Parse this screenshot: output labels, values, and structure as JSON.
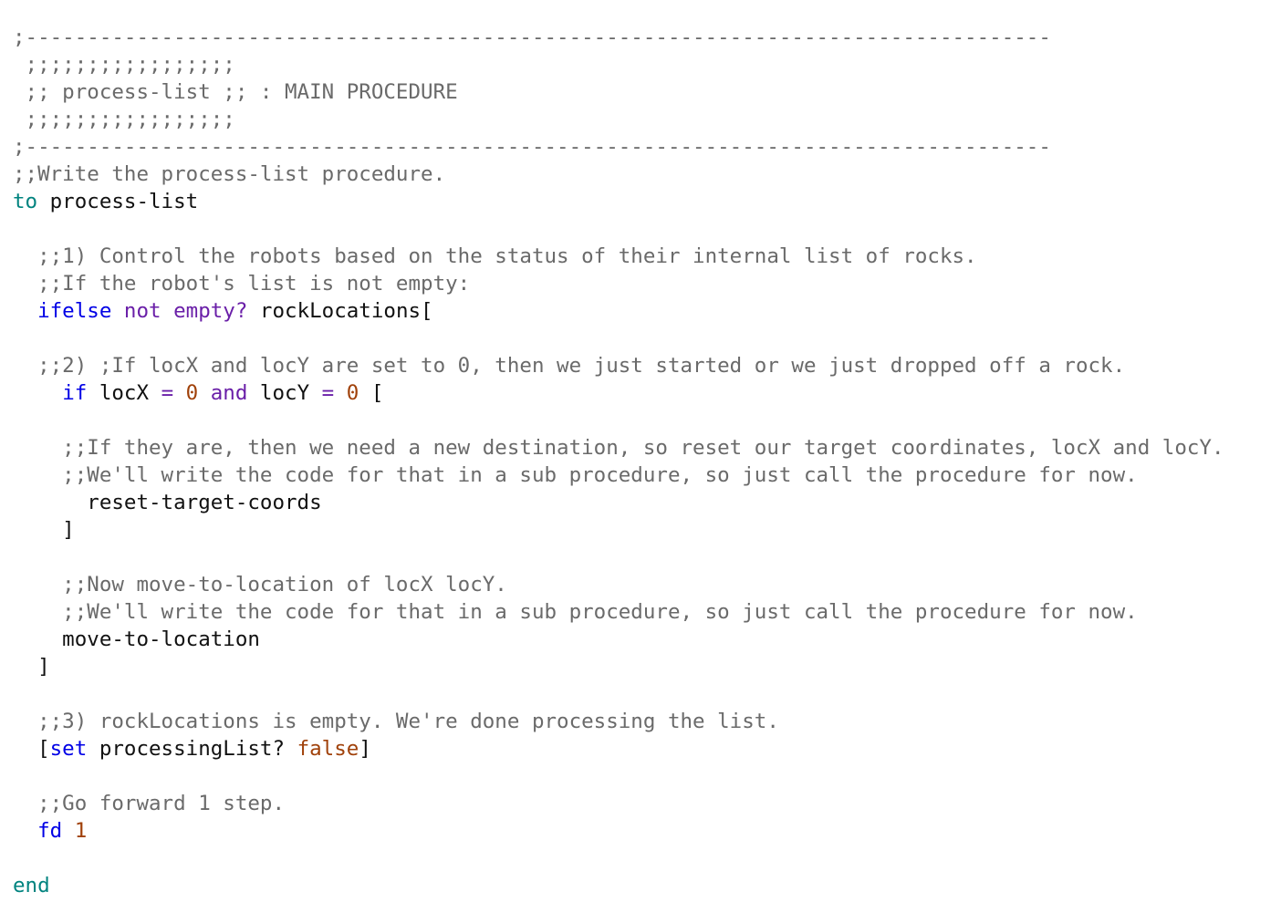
{
  "colors": {
    "comment": "#6a6a6a",
    "keyword_teal": "#00837f",
    "keyword_blue": "#0000e6",
    "keyword_purple": "#6a1fa8",
    "number": "#a0410a",
    "text": "#111111"
  },
  "code_lines": [
    [
      {
        "t": ";-----------------------------------------------------------------------------------",
        "c": "comment"
      }
    ],
    [
      {
        "t": " ;;;;;;;;;;;;;;;;;",
        "c": "comment"
      }
    ],
    [
      {
        "t": " ;; process-list ;; : MAIN PROCEDURE",
        "c": "comment"
      }
    ],
    [
      {
        "t": " ;;;;;;;;;;;;;;;;;",
        "c": "comment"
      }
    ],
    [
      {
        "t": ";-----------------------------------------------------------------------------------",
        "c": "comment"
      }
    ],
    [
      {
        "t": ";;Write the process-list procedure.",
        "c": "comment"
      }
    ],
    [
      {
        "t": "to",
        "c": "kw-teal"
      },
      {
        "t": " process-list",
        "c": "plain"
      }
    ],
    [],
    [
      {
        "t": "  ;;1) Control the robots based on the status of their internal list of rocks.",
        "c": "comment"
      }
    ],
    [
      {
        "t": "  ;;If the robot's list is not empty:",
        "c": "comment"
      }
    ],
    [
      {
        "t": "  ",
        "c": "plain"
      },
      {
        "t": "ifelse",
        "c": "kw-blue"
      },
      {
        "t": " ",
        "c": "plain"
      },
      {
        "t": "not",
        "c": "kw-purple"
      },
      {
        "t": " ",
        "c": "plain"
      },
      {
        "t": "empty?",
        "c": "kw-purple"
      },
      {
        "t": " rockLocations[",
        "c": "plain"
      }
    ],
    [],
    [
      {
        "t": "  ;;2) ;If locX and locY are set to 0, then we just started or we just dropped off a rock.",
        "c": "comment"
      }
    ],
    [
      {
        "t": "    ",
        "c": "plain"
      },
      {
        "t": "if",
        "c": "kw-blue"
      },
      {
        "t": " locX ",
        "c": "plain"
      },
      {
        "t": "=",
        "c": "kw-purple"
      },
      {
        "t": " ",
        "c": "plain"
      },
      {
        "t": "0",
        "c": "num"
      },
      {
        "t": " ",
        "c": "plain"
      },
      {
        "t": "and",
        "c": "kw-purple"
      },
      {
        "t": " locY ",
        "c": "plain"
      },
      {
        "t": "=",
        "c": "kw-purple"
      },
      {
        "t": " ",
        "c": "plain"
      },
      {
        "t": "0",
        "c": "num"
      },
      {
        "t": " [",
        "c": "plain"
      }
    ],
    [],
    [
      {
        "t": "    ;;If they are, then we need a new destination, so reset our target coordinates, locX and locY.",
        "c": "comment"
      }
    ],
    [
      {
        "t": "    ;;We'll write the code for that in a sub procedure, so just call the procedure for now.",
        "c": "comment"
      }
    ],
    [
      {
        "t": "      reset-target-coords",
        "c": "plain"
      }
    ],
    [
      {
        "t": "    ]",
        "c": "plain"
      }
    ],
    [],
    [
      {
        "t": "    ;;Now move-to-location of locX locY.",
        "c": "comment"
      }
    ],
    [
      {
        "t": "    ;;We'll write the code for that in a sub procedure, so just call the procedure for now.",
        "c": "comment"
      }
    ],
    [
      {
        "t": "    move-to-location",
        "c": "plain"
      }
    ],
    [
      {
        "t": "  ]",
        "c": "plain"
      }
    ],
    [],
    [
      {
        "t": "  ;;3) rockLocations is empty. We're done processing the list.",
        "c": "comment"
      }
    ],
    [
      {
        "t": "  [",
        "c": "plain"
      },
      {
        "t": "set",
        "c": "kw-blue"
      },
      {
        "t": " processingList? ",
        "c": "plain"
      },
      {
        "t": "false",
        "c": "num"
      },
      {
        "t": "]",
        "c": "plain"
      }
    ],
    [],
    [
      {
        "t": "  ;;Go forward 1 step.",
        "c": "comment"
      }
    ],
    [
      {
        "t": "  ",
        "c": "plain"
      },
      {
        "t": "fd",
        "c": "kw-blue"
      },
      {
        "t": " ",
        "c": "plain"
      },
      {
        "t": "1",
        "c": "num"
      }
    ],
    [],
    [
      {
        "t": "end",
        "c": "kw-teal"
      }
    ]
  ]
}
